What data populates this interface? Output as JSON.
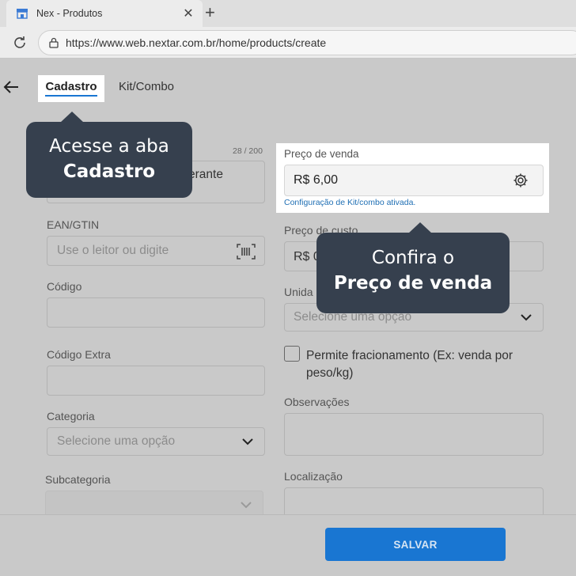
{
  "browser": {
    "tab_title": "Nex - Produtos",
    "url": "https://www.web.nextar.com.br/home/products/create"
  },
  "tabs": {
    "cadastro": "Cadastro",
    "kit": "Kit/Combo"
  },
  "tooltip_cadastro": {
    "line1": "Acesse a aba",
    "line2": "Cadastro"
  },
  "tooltip_price": {
    "line1": "Confira o",
    "line2": "Preço de venda"
  },
  "form": {
    "name_counter": "28 / 200",
    "name_value_partial": "erante",
    "ean_label": "EAN/GTIN",
    "ean_placeholder": "Use o leitor ou digite",
    "codigo_label": "Código",
    "codigo_extra_label": "Código Extra",
    "categoria_label": "Categoria",
    "categoria_placeholder": "Selecione uma opção",
    "subcategoria_label": "Subcategoria",
    "preco_venda_label": "Preço de venda",
    "preco_venda_value": "R$ 6,00",
    "preco_venda_note": "Configuração de Kit/combo ativada.",
    "preco_custo_label": "Preço de custo",
    "preco_custo_value_partial": "R$ 0",
    "unidade_label_partial": "Unida",
    "unidade_placeholder": "Selecione uma opção",
    "fracionamento_label": "Permite fracionamento (Ex: venda por peso/kg)",
    "observacoes_label": "Observações",
    "localizacao_label": "Localização"
  },
  "footer": {
    "save_label": "SALVAR"
  },
  "colors": {
    "accent": "#1976d2",
    "tooltip_bg": "#36404e",
    "overlay_bg": "#c9c9c9"
  }
}
